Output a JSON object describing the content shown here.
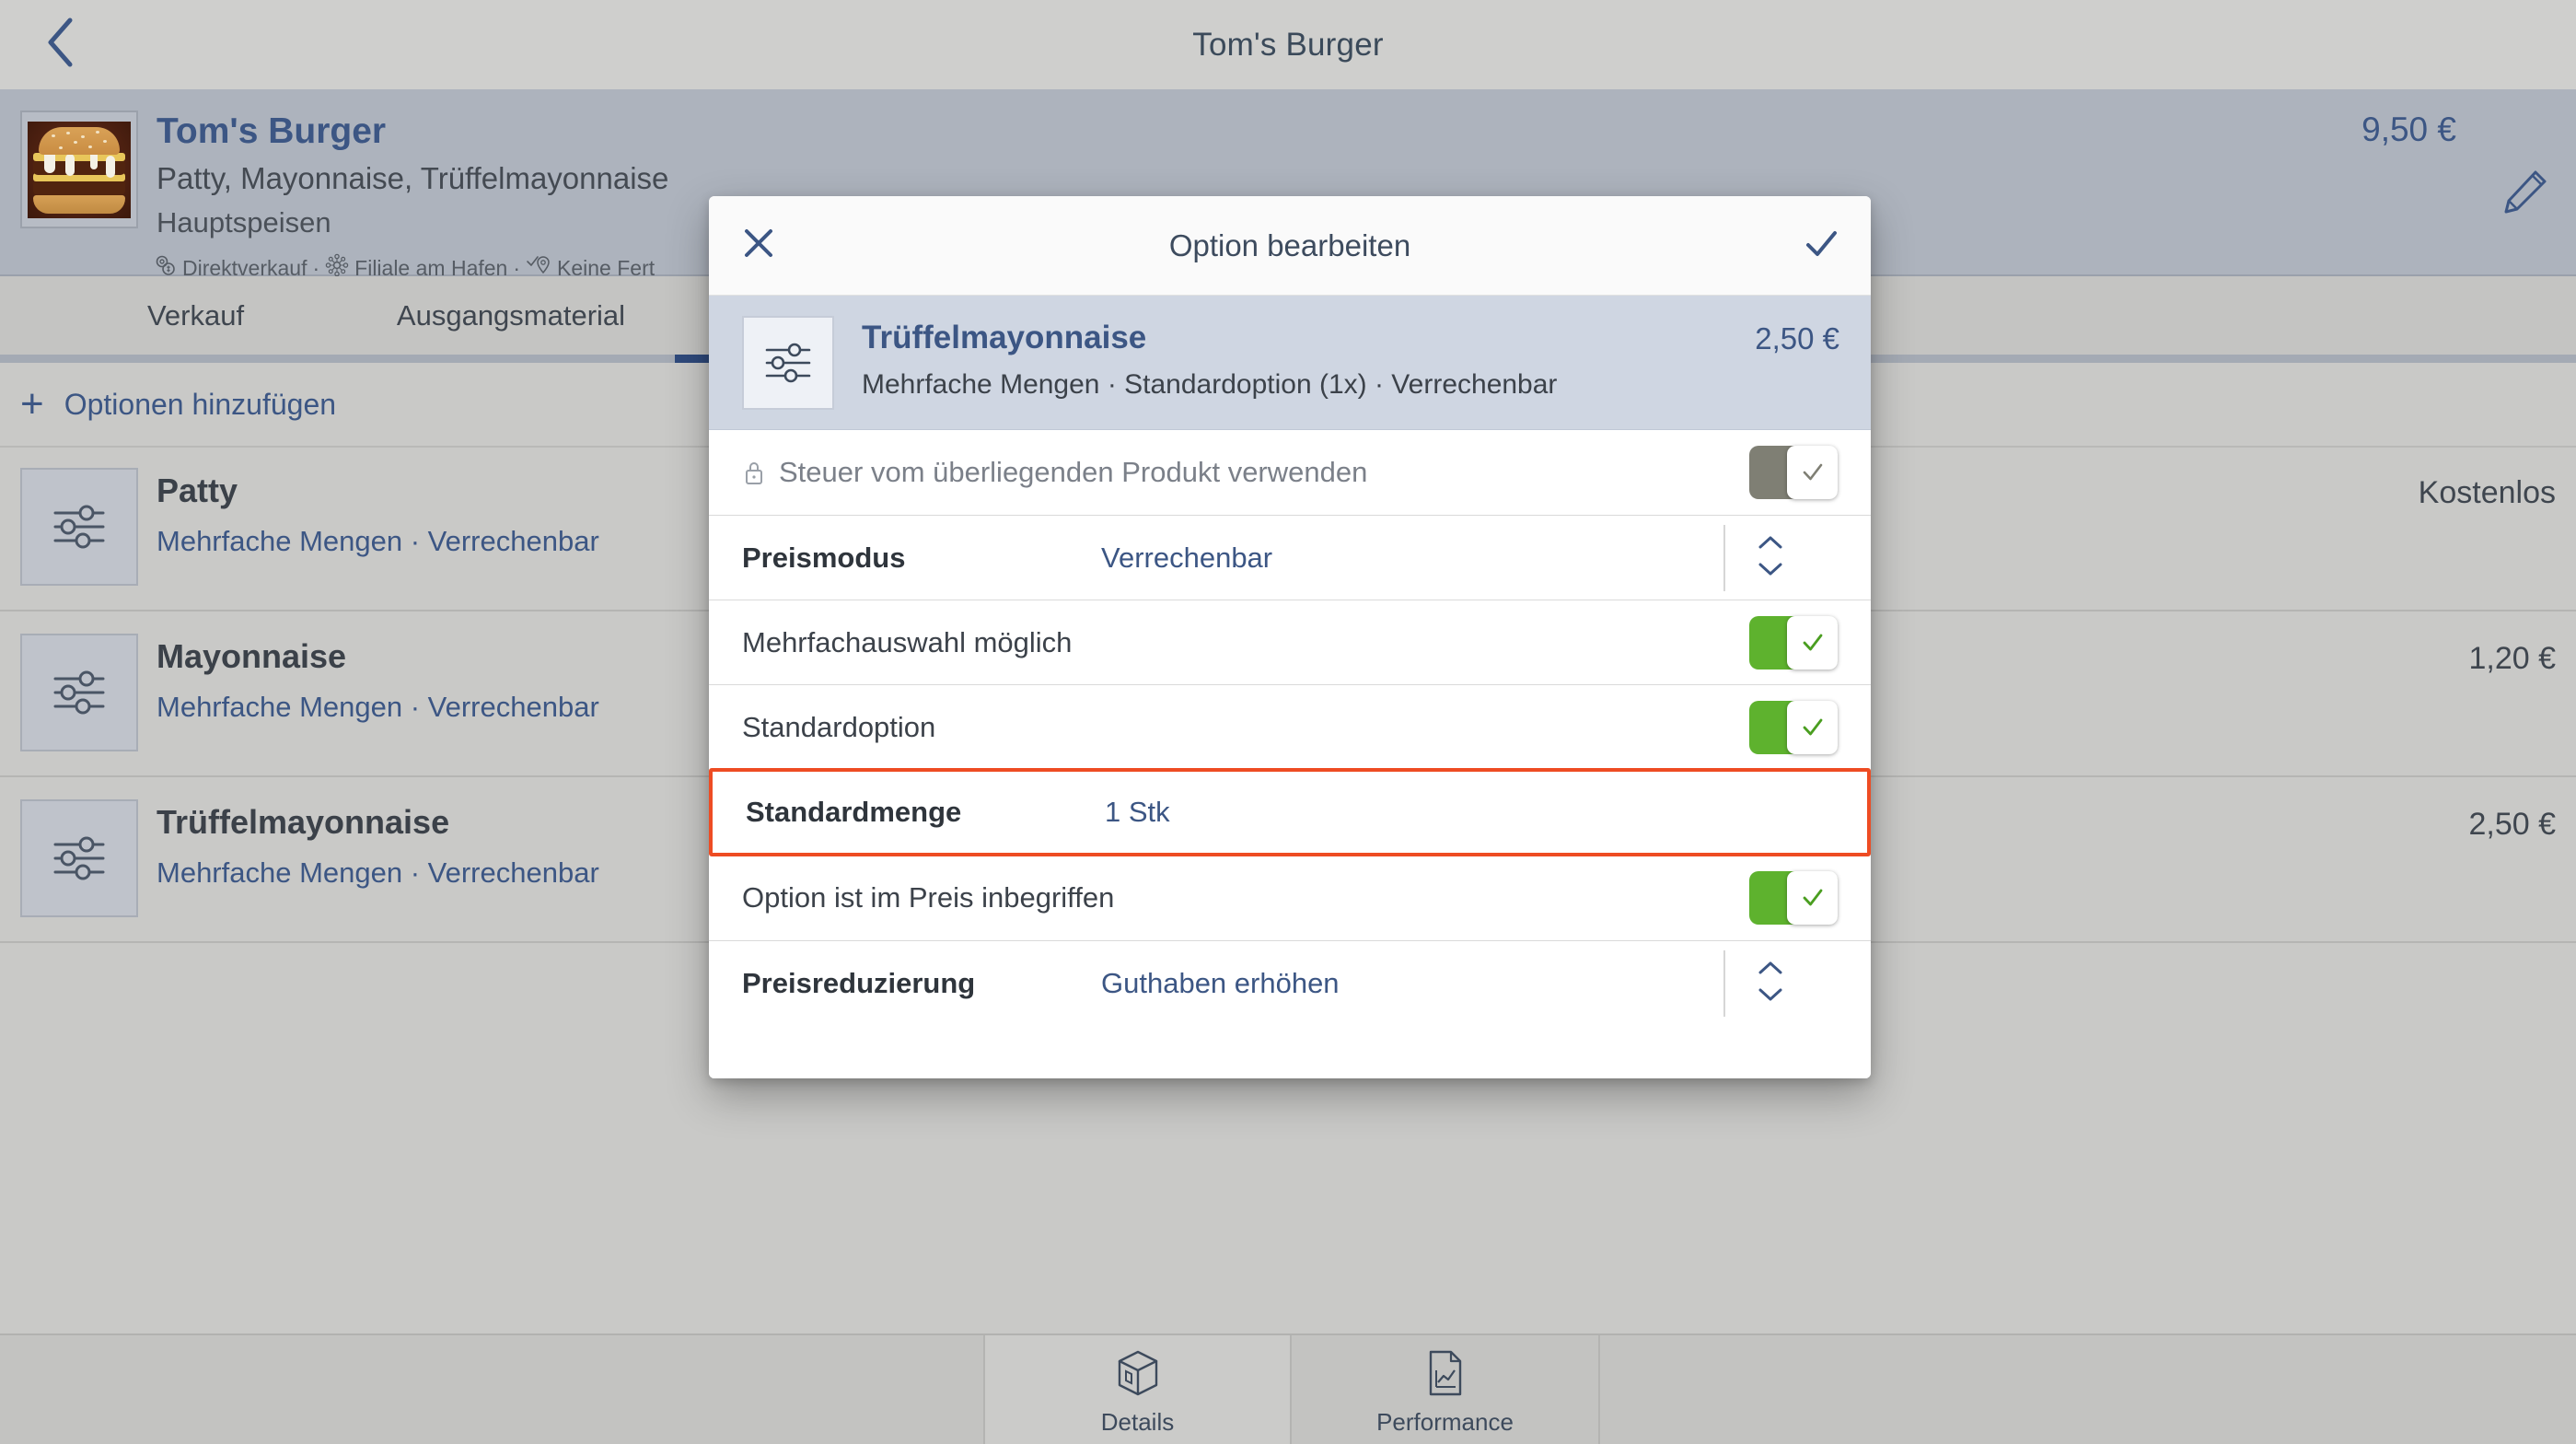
{
  "topbar": {
    "back_icon": "chevron-left-icon",
    "title": "Tom's Burger"
  },
  "product": {
    "thumbnail_alt": "burger-photo",
    "name": "Tom's Burger",
    "ingredients": "Patty, Mayonnaise, Trüffelmayonnaise",
    "category": "Hauptspeisen",
    "meta": "Direktverkauf · Filiale am Hafen · Keine Fert",
    "meta_parts": [
      "Direktverkauf",
      "Filiale am Hafen",
      "Keine Fert"
    ],
    "price": "9,50 €",
    "edit_icon": "pencil-icon"
  },
  "tabs": [
    {
      "label": "Verkauf",
      "active": false
    },
    {
      "label": "Ausgangsmaterial",
      "active": false
    }
  ],
  "add_options": {
    "plus": "+",
    "label": "Optionen hinzufügen"
  },
  "options_list": [
    {
      "name": "Patty",
      "subtitle": "Mehrfache Mengen · Verrechenbar",
      "price": "Kostenlos",
      "icon": "sliders-icon"
    },
    {
      "name": "Mayonnaise",
      "subtitle": "Mehrfache Mengen · Verrechenbar",
      "price": "1,20 €",
      "icon": "sliders-icon"
    },
    {
      "name": "Trüffelmayonnaise",
      "subtitle": "Mehrfache Mengen · Verrechenbar",
      "price": "2,50 €",
      "icon": "sliders-icon"
    }
  ],
  "bottom_tabs": [
    {
      "label": "Details",
      "icon": "box-icon",
      "active": true
    },
    {
      "label": "Performance",
      "icon": "chart-document-icon",
      "active": false
    }
  ],
  "modal": {
    "close_icon": "close-icon",
    "title": "Option bearbeiten",
    "confirm_icon": "check-icon",
    "subject": {
      "icon": "sliders-icon",
      "name": "Trüffelmayonnaise",
      "subtitle": "Mehrfache Mengen · Standardoption (1x) · Verrechenbar",
      "price": "2,50 €"
    },
    "rows": [
      {
        "type": "toggle",
        "label": "Steuer vom überliegenden Produkt verwenden",
        "locked": true,
        "state": "off",
        "state_label": "Aus"
      },
      {
        "type": "select",
        "label": "Preismodus",
        "value": "Verrechenbar"
      },
      {
        "type": "toggle",
        "label": "Mehrfachauswahl möglich",
        "locked": false,
        "state": "on",
        "state_label": "Ein"
      },
      {
        "type": "toggle",
        "label": "Standardoption",
        "locked": false,
        "state": "on",
        "state_label": "Ein"
      },
      {
        "type": "value",
        "label": "Standardmenge",
        "value": "1 Stk",
        "highlighted": true
      },
      {
        "type": "toggle",
        "label": "Option ist im Preis inbegriffen",
        "locked": false,
        "state": "on",
        "state_label": "Ein"
      },
      {
        "type": "select",
        "label": "Preisreduzierung",
        "value": "Guthaben erhöhen"
      }
    ]
  },
  "colors": {
    "accent_blue": "#3c5684",
    "toggle_on": "#5eb22e",
    "toggle_off": "#7f7f74",
    "highlight_red": "#ee4c23",
    "page_bg": "#c9c9c7",
    "header_bg": "#adb3bd"
  }
}
